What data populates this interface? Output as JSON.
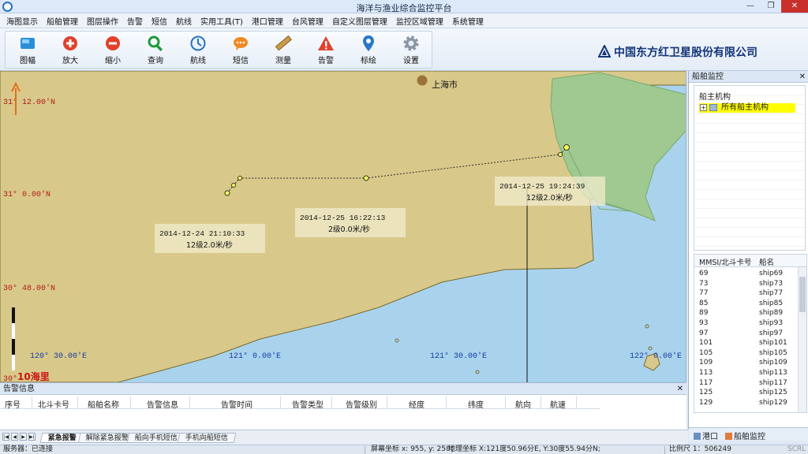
{
  "window": {
    "title": "海洋与渔业综合监控平台",
    "minimize": "—",
    "restore": "❐",
    "close": "✕"
  },
  "menu": [
    "海图显示",
    "船舶管理",
    "图层操作",
    "告警",
    "短信",
    "航线",
    "实用工具(T)",
    "港口管理",
    "台风管理",
    "自定义图层管理",
    "监控区域管理",
    "系统管理"
  ],
  "toolbar": {
    "tools": [
      {
        "label": "图幅",
        "icon": "map-sheet-icon"
      },
      {
        "label": "放大",
        "icon": "zoom-in-icon"
      },
      {
        "label": "缩小",
        "icon": "zoom-out-icon"
      },
      {
        "label": "查询",
        "icon": "search-icon"
      },
      {
        "label": "航线",
        "icon": "route-icon"
      },
      {
        "label": "短信",
        "icon": "message-icon"
      },
      {
        "label": "测量",
        "icon": "ruler-icon"
      },
      {
        "label": "告警",
        "icon": "alarm-icon"
      },
      {
        "label": "标绘",
        "icon": "pin-icon"
      },
      {
        "label": "设置",
        "icon": "gear-icon"
      }
    ],
    "company": "中国东方红卫星股份有限公司"
  },
  "map": {
    "city_label": "上海市",
    "lat_labels": [
      "31° 12.00'N",
      "31° 0.00'N",
      "30° 48.00'N",
      "30°"
    ],
    "lon_labels": [
      "120° 30.00'E",
      "121° 0.00'E",
      "121° 30.00'E",
      "122° 0.00'E"
    ],
    "scale_label": "10海里",
    "track_labels": [
      {
        "time": "2014-12-24 21:10:33",
        "info": "12级2.0米/秒"
      },
      {
        "time": "2014-12-25 16:22:13",
        "info": "2级0.0米/秒"
      },
      {
        "time": "2014-12-25 19:24:39",
        "info": "12级2.0米/秒"
      }
    ],
    "colors": {
      "land": "#d8c98a",
      "sea": "#a9d3ec",
      "green": "#9fc991",
      "coast": "#7a6a32",
      "track": "#2b2b2b",
      "lat_text": "#b11a1a",
      "lon_text": "#1a3aa6"
    }
  },
  "ship_monitor": {
    "title": "船舶监控",
    "close": "✕",
    "tree_title": "船主机构",
    "tree_item": "所有船主机构",
    "col_id": "MMSI/北斗卡号",
    "col_name": "船名",
    "ships": [
      {
        "id": "69",
        "name": "ship69"
      },
      {
        "id": "73",
        "name": "ship73"
      },
      {
        "id": "77",
        "name": "ship77"
      },
      {
        "id": "85",
        "name": "ship85"
      },
      {
        "id": "89",
        "name": "ship89"
      },
      {
        "id": "93",
        "name": "ship93"
      },
      {
        "id": "97",
        "name": "ship97"
      },
      {
        "id": "101",
        "name": "ship101"
      },
      {
        "id": "105",
        "name": "ship105"
      },
      {
        "id": "109",
        "name": "ship109"
      },
      {
        "id": "113",
        "name": "ship113"
      },
      {
        "id": "117",
        "name": "ship117"
      },
      {
        "id": "125",
        "name": "ship125"
      },
      {
        "id": "129",
        "name": "ship129"
      }
    ],
    "tab_port": "港口",
    "tab_ship": "船舶监控"
  },
  "alarm": {
    "title": "告警信息",
    "close": "✕",
    "columns": [
      "序号",
      "北斗卡号",
      "船舶名称",
      "告警信息",
      "告警时间",
      "告警类型",
      "告警级别",
      "经度",
      "纬度",
      "航向",
      "航速"
    ]
  },
  "bottom_tabs": [
    "紧急报警",
    "解除紧急报警",
    "船向手机短信",
    "手机向船短信"
  ],
  "status": {
    "server": "服务器：已连接",
    "screen": "屏幕坐标 x: 955, y: 258；",
    "geo": "地理坐标 X:121度50.96分E, Y:30度55.94分N;",
    "scale": "比例尺 1：506249",
    "caps": "SCRL"
  }
}
